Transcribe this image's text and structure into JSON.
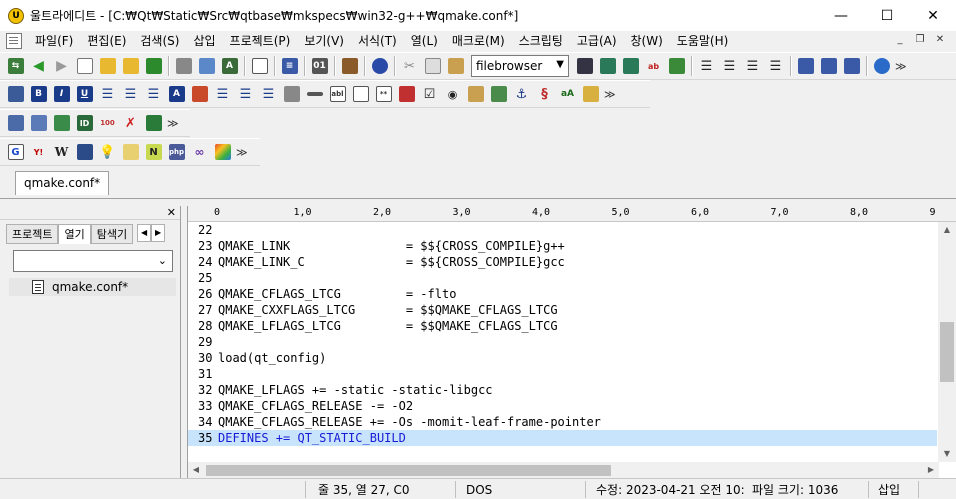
{
  "window": {
    "title": "울트라에디트 - [C:₩Qt₩Static₩Src₩qtbase₩mkspecs₩win32-g++₩qmake.conf*]",
    "controls": {
      "minimize": "—",
      "maximize": "☐",
      "close": "✕"
    }
  },
  "menu": [
    {
      "label": "파일(F)"
    },
    {
      "label": "편집(E)"
    },
    {
      "label": "검색(S)"
    },
    {
      "label": "삽입"
    },
    {
      "label": "프로젝트(P)"
    },
    {
      "label": "보기(V)"
    },
    {
      "label": "서식(T)"
    },
    {
      "label": "열(L)"
    },
    {
      "label": "매크로(M)"
    },
    {
      "label": "스크립팅"
    },
    {
      "label": "고급(A)"
    },
    {
      "label": "창(W)"
    },
    {
      "label": "도움말(H)"
    }
  ],
  "toolbar": {
    "combo_value": "filebrowser"
  },
  "tabs": [
    {
      "label": "qmake.conf*"
    }
  ],
  "panel": {
    "tabs": [
      "프로젝트",
      "열기",
      "탐색기"
    ],
    "combo_value": "",
    "files": [
      {
        "name": "qmake.conf*"
      }
    ]
  },
  "ruler": [
    "0",
    "1,0",
    "2,0",
    "3,0",
    "4,0",
    "5,0",
    "6,0",
    "7,0",
    "8,0",
    "9"
  ],
  "editor": {
    "lines": [
      {
        "num": "22",
        "text": ""
      },
      {
        "num": "23",
        "text": "QMAKE_LINK                = $${CROSS_COMPILE}g++"
      },
      {
        "num": "24",
        "text": "QMAKE_LINK_C              = $${CROSS_COMPILE}gcc"
      },
      {
        "num": "25",
        "text": ""
      },
      {
        "num": "26",
        "text": "QMAKE_CFLAGS_LTCG         = -flto"
      },
      {
        "num": "27",
        "text": "QMAKE_CXXFLAGS_LTCG       = $$QMAKE_CFLAGS_LTCG"
      },
      {
        "num": "28",
        "text": "QMAKE_LFLAGS_LTCG         = $$QMAKE_CFLAGS_LTCG"
      },
      {
        "num": "29",
        "text": ""
      },
      {
        "num": "30",
        "text": "load(qt_config)"
      },
      {
        "num": "31",
        "text": ""
      },
      {
        "num": "32",
        "text": "QMAKE_LFLAGS += -static -static-libgcc"
      },
      {
        "num": "33",
        "text": "QMAKE_CFLAGS_RELEASE -= -O2"
      },
      {
        "num": "34",
        "text": "QMAKE_CFLAGS_RELEASE += -Os -momit-leaf-frame-pointer"
      },
      {
        "num": "35",
        "text": "DEFINES += QT_STATIC_BUILD",
        "highlighted": true
      }
    ]
  },
  "status": {
    "position": "줄 35, 열 27, C0",
    "line_ending": "DOS",
    "modified": "수정: 2023-04-21 오전 10:",
    "file_size": "파일 크기: 1036",
    "mode": "삽입"
  },
  "colors": {
    "highlight_bg": "#c8e4fc",
    "highlight_text": "#1a1ad6",
    "window_bg": "#f0f0f0"
  }
}
